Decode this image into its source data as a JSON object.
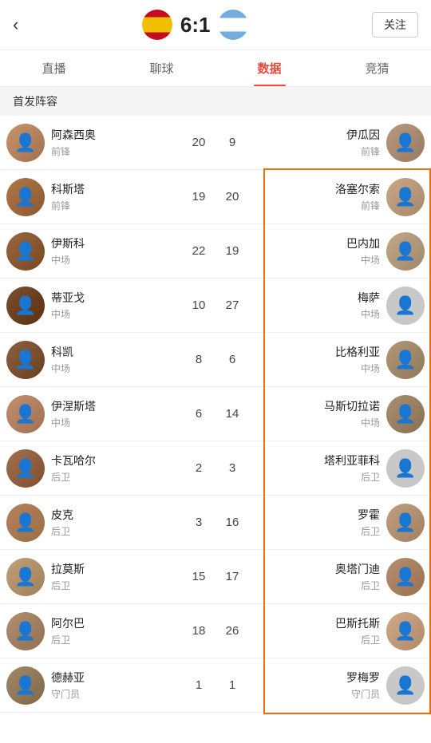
{
  "header": {
    "back_icon": "←",
    "score": "6:1",
    "follow_label": "关注"
  },
  "tabs": [
    {
      "label": "直播",
      "active": false
    },
    {
      "label": "聊球",
      "active": false
    },
    {
      "label": "数据",
      "active": true
    },
    {
      "label": "竞猜",
      "active": false
    }
  ],
  "section": {
    "title": "首发阵容"
  },
  "players": [
    {
      "left": {
        "name": "阿森西奥",
        "pos": "前锋",
        "num_l": "20"
      },
      "num_r": "9",
      "right": {
        "name": "伊瓜因",
        "pos": "前锋"
      }
    },
    {
      "left": {
        "name": "科斯塔",
        "pos": "前锋",
        "num_l": "19"
      },
      "num_r": "20",
      "right": {
        "name": "洛塞尔索",
        "pos": "前锋"
      },
      "highlight": true
    },
    {
      "left": {
        "name": "伊斯科",
        "pos": "中场",
        "num_l": "22"
      },
      "num_r": "19",
      "right": {
        "name": "巴内加",
        "pos": "中场"
      },
      "highlight": true
    },
    {
      "left": {
        "name": "蒂亚戈",
        "pos": "中场",
        "num_l": "10"
      },
      "num_r": "27",
      "right": {
        "name": "梅萨",
        "pos": "中场"
      },
      "highlight": true
    },
    {
      "left": {
        "name": "科凯",
        "pos": "中场",
        "num_l": "8"
      },
      "num_r": "6",
      "right": {
        "name": "比格利亚",
        "pos": "中场"
      },
      "highlight": true
    },
    {
      "left": {
        "name": "伊涅斯塔",
        "pos": "中场",
        "num_l": "6"
      },
      "num_r": "14",
      "right": {
        "name": "马斯切拉诺",
        "pos": "中场"
      },
      "highlight": true
    },
    {
      "left": {
        "name": "卡瓦哈尔",
        "pos": "后卫",
        "num_l": "2"
      },
      "num_r": "3",
      "right": {
        "name": "塔利亚菲科",
        "pos": "后卫"
      },
      "highlight": true
    },
    {
      "left": {
        "name": "皮克",
        "pos": "后卫",
        "num_l": "3"
      },
      "num_r": "16",
      "right": {
        "name": "罗霍",
        "pos": "后卫"
      },
      "highlight": true
    },
    {
      "left": {
        "name": "拉莫斯",
        "pos": "后卫",
        "num_l": "15"
      },
      "num_r": "17",
      "right": {
        "name": "奥塔门迪",
        "pos": "后卫"
      },
      "highlight": true
    },
    {
      "left": {
        "name": "阿尔巴",
        "pos": "后卫",
        "num_l": "18"
      },
      "num_r": "26",
      "right": {
        "name": "巴斯托斯",
        "pos": "后卫"
      },
      "highlight": true
    },
    {
      "left": {
        "name": "德赫亚",
        "pos": "守门员",
        "num_l": "1"
      },
      "num_r": "1",
      "right": {
        "name": "罗梅罗",
        "pos": "守门员"
      }
    }
  ],
  "avatar_colors": {
    "spain": [
      "#c8956a",
      "#b07848",
      "#9a6840",
      "#7a5030",
      "#8a6040",
      "#c09070",
      "#a07050",
      "#b88060",
      "#c0a078",
      "#b09070",
      "#a08868"
    ],
    "argentina": [
      "#b89a80",
      "#c8a888",
      "#c8c8c8",
      "#c8c8c8",
      "#b09878",
      "#a89070",
      "#c8c8c8",
      "#c0a080",
      "#b89070",
      "#d0aa88",
      "#c8c8c8"
    ]
  }
}
